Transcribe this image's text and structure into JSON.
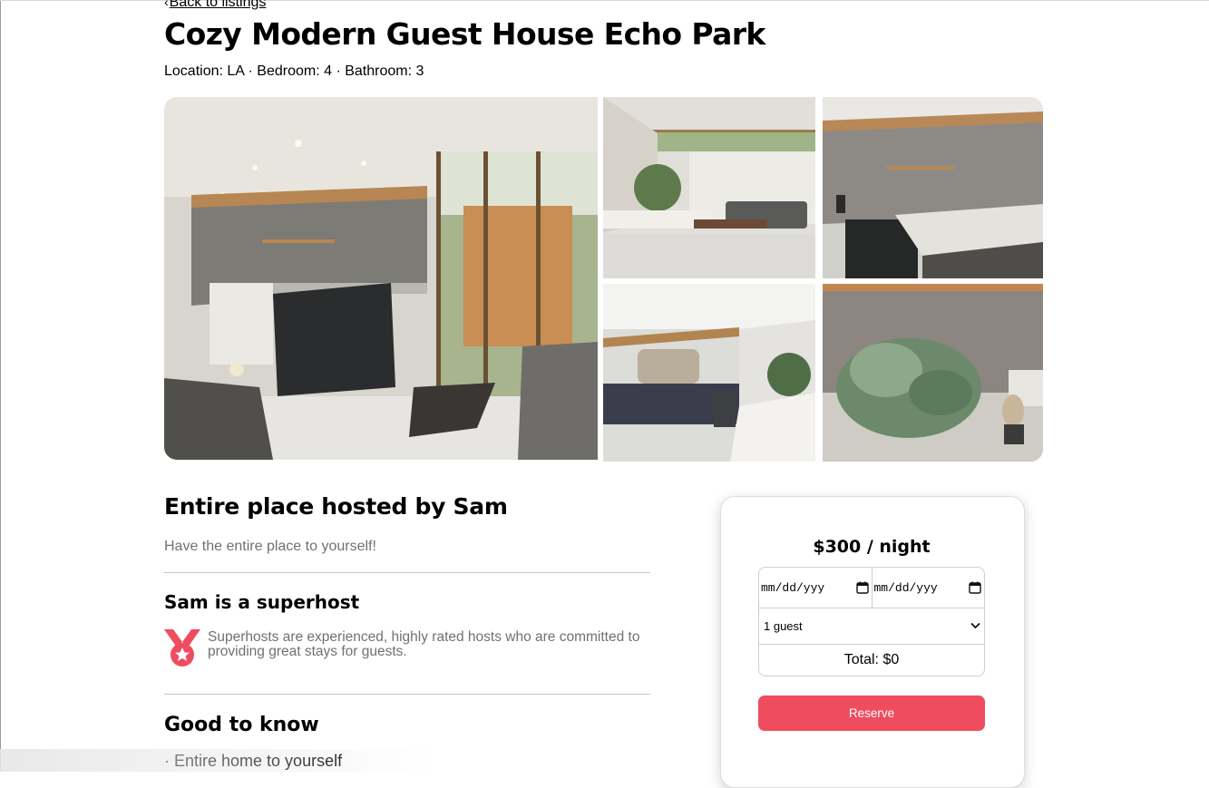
{
  "nav": {
    "back_arrow": "‹",
    "back_label": "Back to listings"
  },
  "listing": {
    "title": "Cozy Modern Guest House Echo Park",
    "meta": "Location: LA · Bedroom: 4 · Bathroom: 3"
  },
  "host": {
    "title": "Entire place hosted by Sam",
    "subtitle": "Have the entire place to yourself!",
    "superhost_title": "Sam is a superhost",
    "superhost_text": "Superhosts are experienced, highly rated hosts who are committed to providing great stays for guests."
  },
  "good_to_know": {
    "title": "Good to know",
    "items": [
      "· Entire home to yourself"
    ]
  },
  "booking": {
    "price": "$300 / night",
    "checkin_placeholder": "mm/dd/yyy",
    "checkout_placeholder": "mm/dd/yyy",
    "guests_selected": "1 guest",
    "total": "Total: $0",
    "reserve_label": "Reserve"
  },
  "colors": {
    "accent": "#ef4c5f",
    "muted_text": "#717171"
  },
  "icons": {
    "back": "chevron-left-icon",
    "calendar": "calendar-icon",
    "select": "chevron-down-icon",
    "superhost": "medal-icon"
  }
}
